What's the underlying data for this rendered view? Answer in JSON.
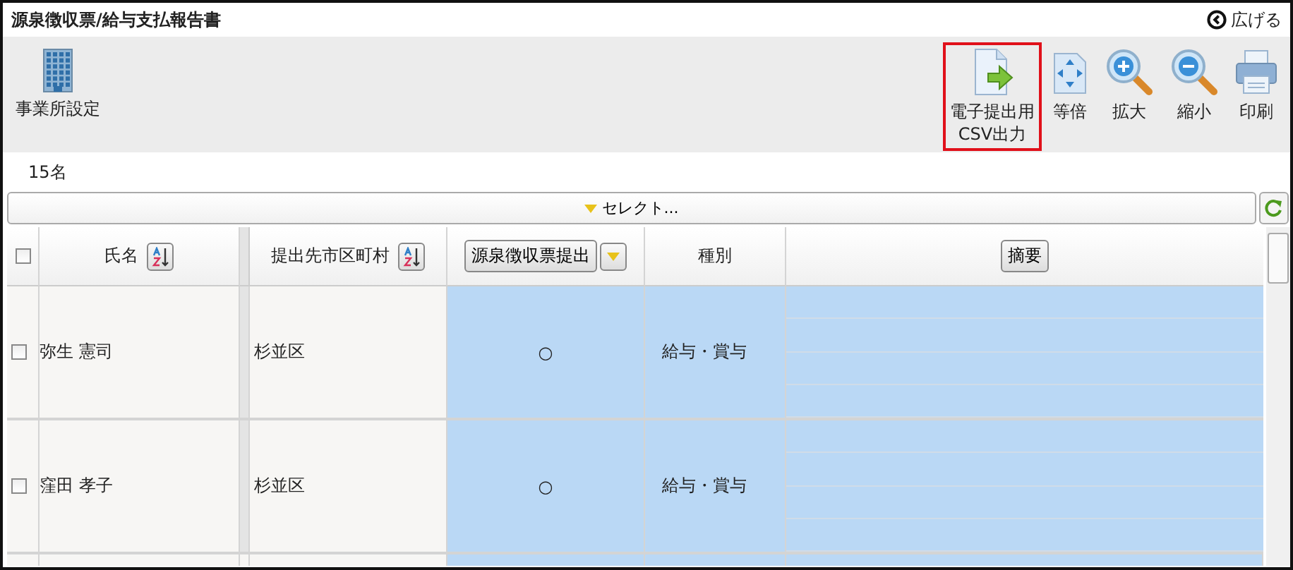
{
  "window": {
    "title": "源泉徴収票/給与支払報告書",
    "expand_label": "広げる"
  },
  "toolbar": {
    "left": [
      {
        "kind": "building",
        "label": "事業所設定",
        "highlighted": false
      }
    ],
    "right": [
      {
        "kind": "export",
        "label": "電子提出用\nCSV出力",
        "highlighted": true
      },
      {
        "kind": "fit",
        "label": "等倍",
        "highlighted": false
      },
      {
        "kind": "zoom-in",
        "label": "拡大",
        "highlighted": false
      },
      {
        "kind": "zoom-out",
        "label": "縮小",
        "highlighted": false
      },
      {
        "kind": "print",
        "label": "印刷",
        "highlighted": false
      }
    ]
  },
  "count": "15名",
  "select_bar": {
    "label": "セレクト..."
  },
  "table": {
    "select_all": {
      "checked": false
    },
    "columns": [
      {
        "kind": "sort",
        "label": "氏名"
      },
      {
        "kind": "sort",
        "label": "提出先市区町村"
      },
      {
        "kind": "dropdown",
        "label": "源泉徴収票提出"
      },
      {
        "kind": "text",
        "label": "種別"
      },
      {
        "kind": "button",
        "label": "摘要"
      }
    ],
    "rows": [
      {
        "checked": false,
        "name": "弥生 憲司",
        "city": "杉並区",
        "submitted": "○",
        "type": "給与・賞与"
      },
      {
        "checked": false,
        "name": "窪田 孝子",
        "city": "杉並区",
        "submitted": "○",
        "type": "給与・賞与"
      }
    ]
  }
}
